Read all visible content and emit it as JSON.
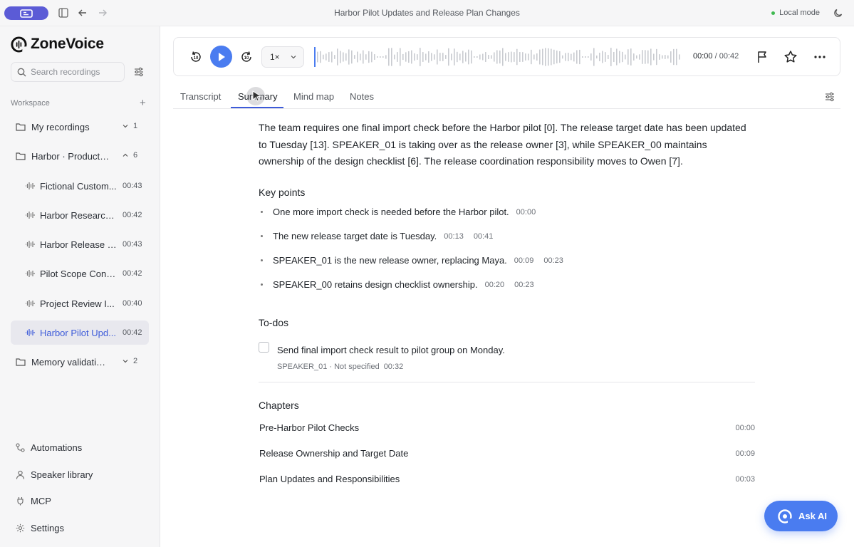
{
  "window": {
    "title": "Harbor Pilot Updates and Release Plan Changes",
    "mode": "Local mode"
  },
  "sidebar": {
    "app_name": "ZoneVoice",
    "search_placeholder": "Search recordings",
    "workspace_label": "Workspace",
    "add_symbol": "+",
    "folders": [
      {
        "label": "My recordings",
        "count": "1",
        "expanded": false
      },
      {
        "label": "Harbor · Product c...",
        "count": "6",
        "expanded": true
      },
      {
        "label": "Memory validation ...",
        "count": "2",
        "expanded": false
      }
    ],
    "recordings": [
      {
        "label": "Fictional Custom...",
        "duration": "00:43",
        "active": false
      },
      {
        "label": "Harbor Research ...",
        "duration": "00:42",
        "active": false
      },
      {
        "label": "Harbor Release P...",
        "duration": "00:43",
        "active": false
      },
      {
        "label": "Pilot Scope Confi...",
        "duration": "00:42",
        "active": false
      },
      {
        "label": "Project Review I...",
        "duration": "00:40",
        "active": false
      },
      {
        "label": "Harbor Pilot Upd...",
        "duration": "00:42",
        "active": true
      }
    ],
    "bottom_nav": [
      {
        "label": "Automations",
        "icon": "automations-icon"
      },
      {
        "label": "Speaker library",
        "icon": "speaker-icon"
      },
      {
        "label": "MCP",
        "icon": "plug-icon"
      },
      {
        "label": "Settings",
        "icon": "gear-icon"
      }
    ]
  },
  "player": {
    "speed": "1×",
    "current_time": "00:00",
    "separator": " / ",
    "total_time": "00:42",
    "progress": 0.0
  },
  "tabs": [
    {
      "label": "Transcript",
      "active": false
    },
    {
      "label": "Summary",
      "active": true
    },
    {
      "label": "Mind map",
      "active": false
    },
    {
      "label": "Notes",
      "active": false
    }
  ],
  "summary": {
    "text": "The team requires one final import check before the Harbor pilot [0]. The release target date has been updated to Tuesday [13]. SPEAKER_01 is taking over as the release owner [3], while SPEAKER_00 maintains ownership of the design checklist [6]. The release coordination responsibility moves to Owen [7].",
    "key_points_title": "Key points",
    "key_points": [
      {
        "text": "One more import check is needed before the Harbor pilot.",
        "times": [
          "00:00"
        ]
      },
      {
        "text": "The new release target date is Tuesday.",
        "times": [
          "00:13",
          "00:41"
        ]
      },
      {
        "text": "SPEAKER_01 is the new release owner, replacing Maya.",
        "times": [
          "00:09",
          "00:23"
        ]
      },
      {
        "text": "SPEAKER_00 retains design checklist ownership.",
        "times": [
          "00:20",
          "00:23"
        ]
      }
    ],
    "todos_title": "To-dos",
    "todos": [
      {
        "text": "Send final import check result to pilot group on Monday.",
        "meta": "SPEAKER_01 · Not specified",
        "time": "00:32",
        "done": false
      }
    ],
    "chapters_title": "Chapters",
    "chapters": [
      {
        "title": "Pre-Harbor Pilot Checks",
        "time": "00:00"
      },
      {
        "title": "Release Ownership and Target Date",
        "time": "00:09"
      },
      {
        "title": "Plan Updates and Responsibilities",
        "time": "00:03"
      }
    ]
  },
  "ask_ai": {
    "label": "Ask AI"
  },
  "colors": {
    "accent": "#4a7cf0",
    "active_text": "#3d5bd9",
    "sidebar_bg": "#f6f6f7"
  }
}
